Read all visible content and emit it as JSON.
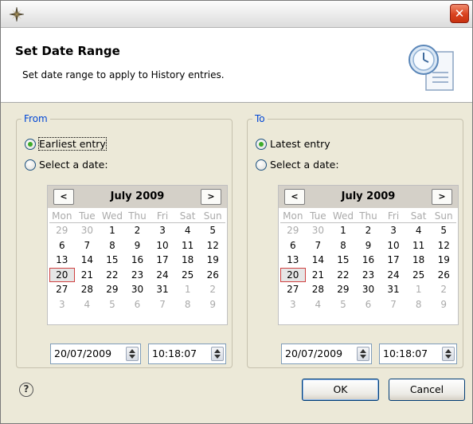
{
  "window": {
    "close_glyph": "✕",
    "icon": "compass-star-icon"
  },
  "header": {
    "title": "Set Date Range",
    "description": "Set date range to apply to History entries.",
    "icon": "clock-document-icon"
  },
  "from": {
    "legend": "From",
    "option_earliest": "Earliest entry",
    "option_select": "Select a date:",
    "selected": "earliest",
    "calendar": {
      "month": "July 2009",
      "prev": "<",
      "next": ">",
      "days": [
        "Mon",
        "Tue",
        "Wed",
        "Thu",
        "Fri",
        "Sat",
        "Sun"
      ],
      "weeks": [
        [
          "29",
          "30",
          "1",
          "2",
          "3",
          "4",
          "5"
        ],
        [
          "6",
          "7",
          "8",
          "9",
          "10",
          "11",
          "12"
        ],
        [
          "13",
          "14",
          "15",
          "16",
          "17",
          "18",
          "19"
        ],
        [
          "20",
          "21",
          "22",
          "23",
          "24",
          "25",
          "26"
        ],
        [
          "27",
          "28",
          "29",
          "30",
          "31",
          "1",
          "2"
        ],
        [
          "3",
          "4",
          "5",
          "6",
          "7",
          "8",
          "9"
        ]
      ]
    },
    "date_value": "20/07/2009",
    "time_value": "10:18:07"
  },
  "to": {
    "legend": "To",
    "option_latest": "Latest entry",
    "option_select": "Select a date:",
    "selected": "latest",
    "calendar": {
      "month": "July 2009",
      "prev": "<",
      "next": ">",
      "days": [
        "Mon",
        "Tue",
        "Wed",
        "Thu",
        "Fri",
        "Sat",
        "Sun"
      ],
      "weeks": [
        [
          "29",
          "30",
          "1",
          "2",
          "3",
          "4",
          "5"
        ],
        [
          "6",
          "7",
          "8",
          "9",
          "10",
          "11",
          "12"
        ],
        [
          "13",
          "14",
          "15",
          "16",
          "17",
          "18",
          "19"
        ],
        [
          "20",
          "21",
          "22",
          "23",
          "24",
          "25",
          "26"
        ],
        [
          "27",
          "28",
          "29",
          "30",
          "31",
          "1",
          "2"
        ],
        [
          "3",
          "4",
          "5",
          "6",
          "7",
          "8",
          "9"
        ]
      ]
    },
    "date_value": "20/07/2009",
    "time_value": "10:18:07"
  },
  "footer": {
    "help_glyph": "?",
    "ok_label": "OK",
    "cancel_label": "Cancel"
  },
  "colors": {
    "legend": "#0046d5",
    "today_border": "#d04040",
    "dialog_bg": "#ece9d8"
  }
}
